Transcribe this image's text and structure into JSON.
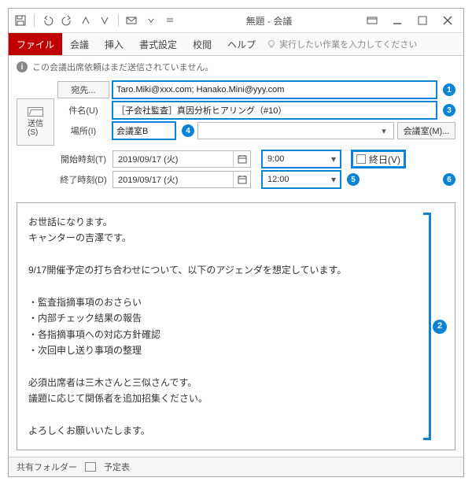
{
  "titlebar": {
    "title": "無題 - 会議"
  },
  "ribbon": {
    "tabs": [
      "ファイル",
      "会議",
      "挿入",
      "書式設定",
      "校閲",
      "ヘルプ"
    ],
    "tellme": "実行したい作業を入力してください"
  },
  "infobar": {
    "text": "この会議出席依頼はまだ送信されていません。"
  },
  "send": {
    "label": "送信",
    "accel": "(S)"
  },
  "form": {
    "to_label": "宛先...",
    "to_value": "Taro.Miki@xxx.com; Hanako.Mini@yyy.com",
    "subject_label": "件名(U)",
    "subject_value": "［子会社監査］真因分析ヒアリング（#10）",
    "location_label": "場所(I)",
    "location_value": "会議室B",
    "rooms_button": "会議室(M)...",
    "start_label": "開始時刻(T)",
    "start_date": "2019/09/17 (火)",
    "start_time": "9:00",
    "end_label": "終了時刻(D)",
    "end_date": "2019/09/17 (火)",
    "end_time": "12:00",
    "allday_label": "終日(V)"
  },
  "badges": {
    "to": "1",
    "body": "2",
    "subject": "3",
    "location": "4",
    "time": "5",
    "allday": "6"
  },
  "body": {
    "text": "お世話になります。\nキャンターの吉澤です。\n\n9/17開催予定の打ち合わせについて、以下のアジェンダを想定しています。\n\n・監査指摘事項のおさらい\n・内部チェック結果の報告\n・各指摘事項への対応方針確認\n・次回申し送り事項の整理\n\n必須出席者は三木さんと三似さんです。\n議題に応じて関係者を追加招集ください。\n\nよろしくお願いいたします。"
  },
  "status": {
    "folder": "共有フォルダー",
    "calendar": "予定表"
  }
}
